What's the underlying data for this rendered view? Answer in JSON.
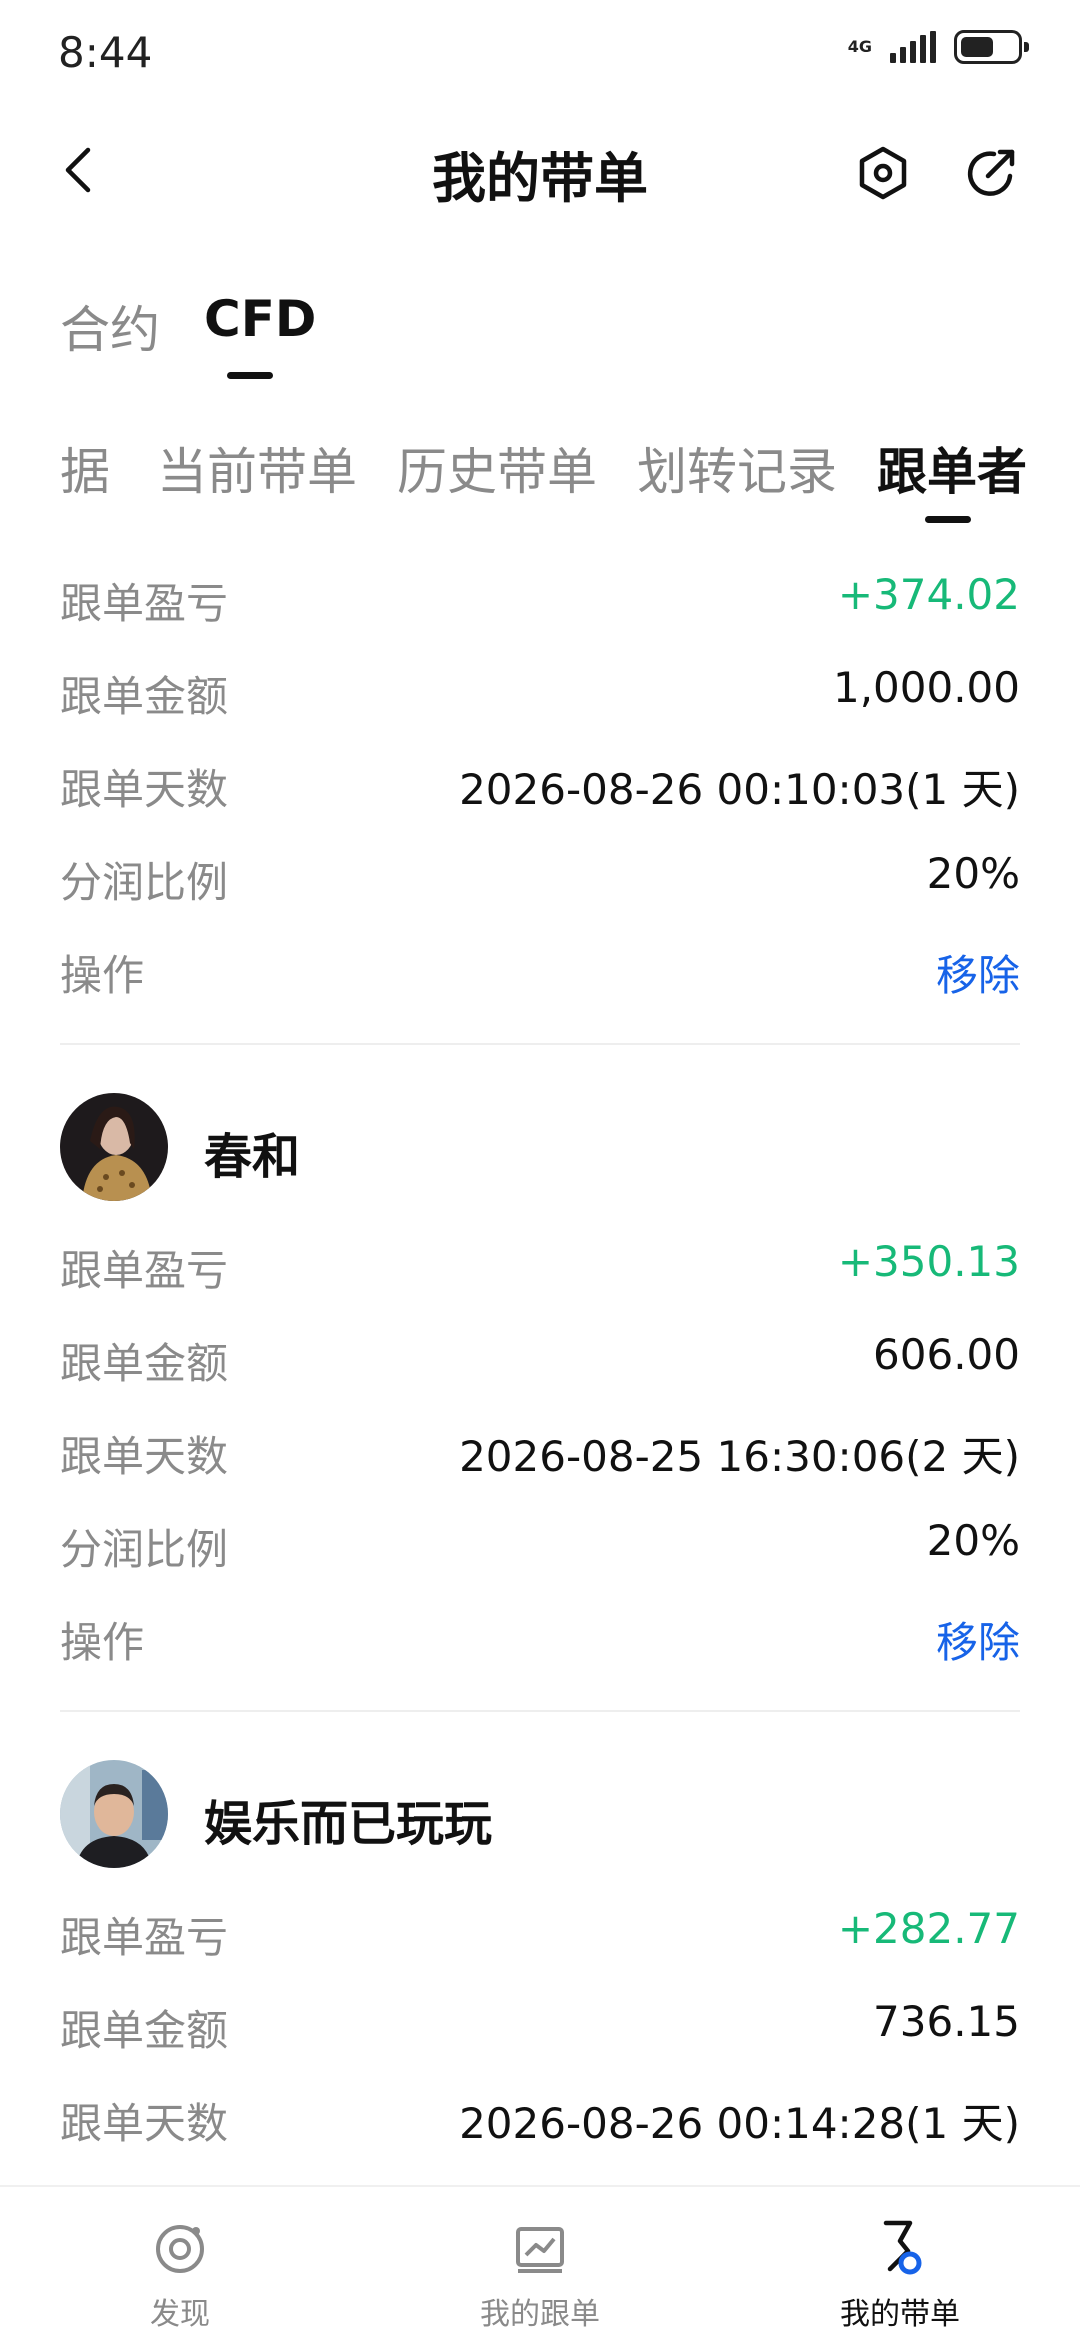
{
  "status": {
    "time": "8:44",
    "signal_label": "4G",
    "battery_level": 0.6
  },
  "header": {
    "title": "我的带单"
  },
  "type_tabs": [
    {
      "label": "合约",
      "active": false
    },
    {
      "label": "CFD",
      "active": true
    }
  ],
  "sub_tabs": [
    {
      "label": "据",
      "active": false
    },
    {
      "label": "当前带单",
      "active": false
    },
    {
      "label": "历史带单",
      "active": false
    },
    {
      "label": "划转记录",
      "active": false
    },
    {
      "label": "跟单者",
      "active": true
    }
  ],
  "followers": [
    {
      "name": "",
      "rows": [
        {
          "label": "跟单盈亏",
          "value": "+374.02"
        },
        {
          "label": "跟单金额",
          "value": "1,000.00"
        },
        {
          "label": "跟单天数",
          "value": "2026-08-26 00:10:03(1 天)"
        },
        {
          "label": "分润比例",
          "value": "20%"
        },
        {
          "label": "操作",
          "value": "移除"
        }
      ]
    },
    {
      "name": "春和",
      "rows": [
        {
          "label": "跟单盈亏",
          "value": "+350.13"
        },
        {
          "label": "跟单金额",
          "value": "606.00"
        },
        {
          "label": "跟单天数",
          "value": "2026-08-25 16:30:06(2 天)"
        },
        {
          "label": "分润比例",
          "value": "20%"
        },
        {
          "label": "操作",
          "value": "移除"
        }
      ]
    },
    {
      "name": "娱乐而已玩玩",
      "rows": [
        {
          "label": "跟单盈亏",
          "value": "+282.77"
        },
        {
          "label": "跟单金额",
          "value": "736.15"
        },
        {
          "label": "跟单天数",
          "value": "2026-08-26 00:14:28(1 天)"
        }
      ]
    }
  ],
  "bottom_nav": [
    {
      "label": "发现",
      "icon": "discover-icon",
      "active": false
    },
    {
      "label": "我的跟单",
      "icon": "chart-icon",
      "active": false
    },
    {
      "label": "我的带单",
      "icon": "lead-trade-icon",
      "active": true
    }
  ],
  "colors": {
    "profit": "#17b978",
    "action": "#1763e8",
    "muted": "#8a8a8a"
  }
}
